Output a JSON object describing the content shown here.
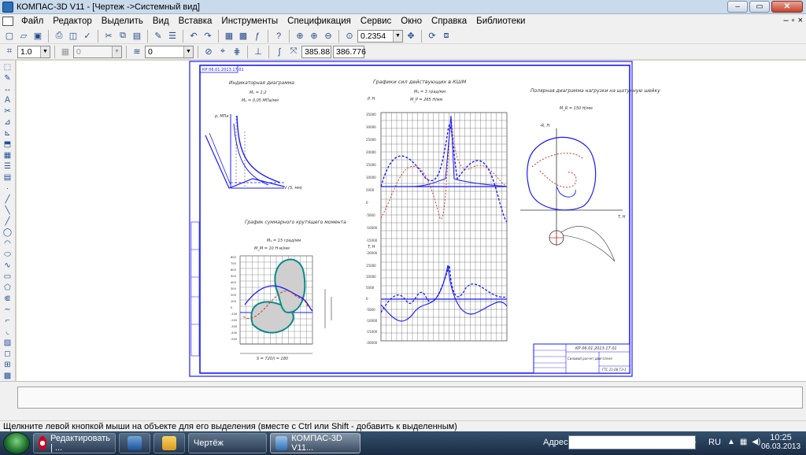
{
  "window": {
    "title": "КОМПАС-3D V11 - [Чертеж ->Системный вид]"
  },
  "menu": {
    "items": [
      "Файл",
      "Редактор",
      "Выделить",
      "Вид",
      "Вставка",
      "Инструменты",
      "Спецификация",
      "Сервис",
      "Окно",
      "Справка",
      "Библиотеки"
    ]
  },
  "toolbar1": {
    "zoom_value": "0.2354"
  },
  "toolbar2": {
    "scale_value": "1.0",
    "style_value": "0",
    "layer_value": "0",
    "coord_x": "385.88",
    "coord_y": "386.776"
  },
  "drawing": {
    "stamp_top": "КР 06.01.2013.17.01",
    "indicator": {
      "title": "Индикаторная диаграмма",
      "scale1": "Mₛ = 1:2",
      "scale2": "Mₚ = 0,05 МПа/мм",
      "ylabel": "p, МПа",
      "xlabel": "V (S, мм)"
    },
    "forces": {
      "title": "Графики сил действующих в КШМ",
      "scale1": "Mᵩ = 3 град/мм",
      "scale2": "M_P = 265 Н/мм",
      "ylabel_top": "P, Н",
      "ylabel_bottom": "T, Н",
      "ticks_top": [
        "35000",
        "30000",
        "25000",
        "20000",
        "15000",
        "10000",
        "5000",
        "0",
        "-5000",
        "-10000",
        "-15000",
        "-20000"
      ],
      "ticks_bottom": [
        "15000",
        "10000",
        "5000",
        "0",
        "-5000",
        "-10000",
        "-15000",
        "-20000"
      ]
    },
    "polar": {
      "title": "Полярная диаграмма нагрузки на шатунную шейку",
      "scale": "M_R = 150 Н/мм",
      "ylabel": "-R, Н",
      "xlabel": "T, Н"
    },
    "torque": {
      "title": "График суммарного крутящего момента",
      "scale1": "Mᵩ = 15 град/мм",
      "scale2": "M_M = 10 Н·м/мм",
      "ticks": [
        "800",
        "700",
        "600",
        "500",
        "400",
        "300",
        "200",
        "100",
        "0",
        "-100",
        "-200",
        "-300",
        "-400",
        "-500"
      ],
      "xlabel": "S = 720/i = 180"
    },
    "title_block": {
      "code": "КР 06.01.2013.17.01",
      "name": "Силовой расчет двигателя",
      "group": "ГТС 11-08 ТЭ-1"
    }
  },
  "status": {
    "hint": "Щелкните левой кнопкой мыши на объекте для его выделения (вместе с Ctrl или Shift - добавить к выделенным)"
  },
  "taskbar": {
    "apps": [
      "Редактировать | ...",
      "Чертёж",
      "КОМПАС-3D V11..."
    ],
    "address_label": "Адрес",
    "lang": "RU",
    "time": "10:25",
    "date": "06.03.2013"
  },
  "colors": {
    "line_blue": "#1a1aff",
    "dash_red": "#c0392b",
    "teal": "#0a8a8a",
    "grid": "#555555"
  },
  "icons": [
    "kompas-app-icon",
    "new-doc-icon",
    "open-icon",
    "save-icon",
    "print-icon",
    "cut-icon",
    "copy-icon",
    "paste-icon",
    "undo-icon",
    "redo-icon",
    "zoom-icon",
    "pan-icon",
    "opera-icon",
    "folder-icon"
  ]
}
